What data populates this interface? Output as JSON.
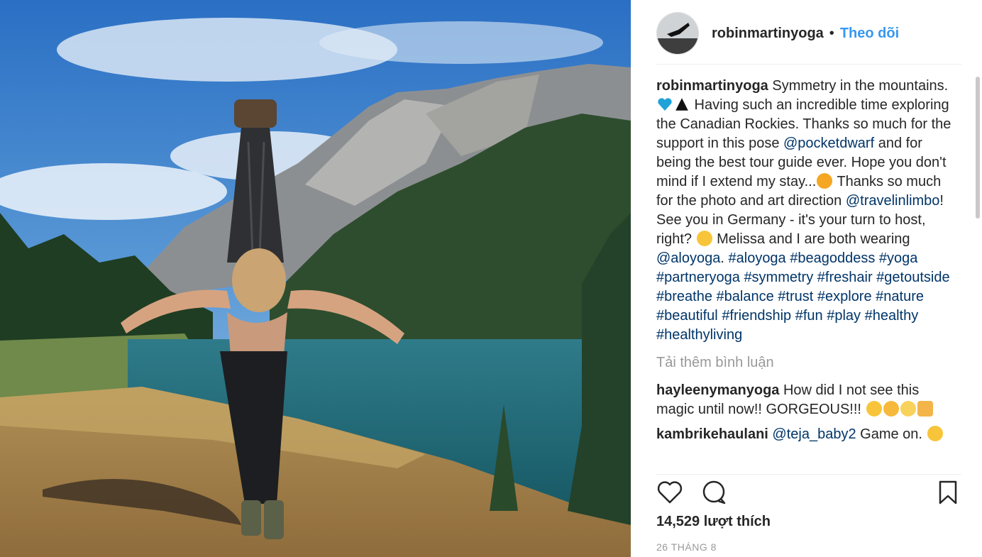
{
  "post": {
    "username": "robinmartinyoga",
    "separator": "•",
    "follow_label": "Theo dõi",
    "photo_icon": "yoga-photo"
  },
  "caption": {
    "username": "robinmartinyoga",
    "part1": " Symmetry in the mountains. ",
    "part2": " Having such an incredible time exploring the Canadian Rockies. Thanks so much for the support in this pose ",
    "mention1": "@pocketdwarf",
    "part3": " and for being the best tour guide ever. Hope you don't mind if I extend my stay...",
    "part4": " Thanks so much for the photo and art direction ",
    "mention2": "@travelinlimbo",
    "part5": "! See you in Germany - it's your turn to host, right? ",
    "part6": " Melissa and I are both wearing ",
    "mention3": "@aloyoga",
    "part7": ".",
    "hashtags": [
      "#aloyoga",
      "#beagoddess",
      "#yoga",
      "#partneryoga",
      "#symmetry",
      "#freshair",
      "#getoutside",
      "#breathe",
      "#balance",
      "#trust",
      "#explore",
      "#nature",
      "#beautiful",
      "#friendship",
      "#fun",
      "#play",
      "#healthy",
      "#healthyliving"
    ]
  },
  "load_more": "Tải thêm bình luận",
  "comments": [
    {
      "username": "hayleenymanyoga",
      "text": " How did I not see this magic until now!! GORGEOUS!!! "
    },
    {
      "username": "kambrikehaulani",
      "mention": "@teja_baby2",
      "text": " Game on. "
    }
  ],
  "icons": [
    "heart-icon",
    "comment-icon",
    "bookmark-icon",
    "blue-heart-emoji",
    "mountain-emoji",
    "wink-emoji",
    "laughing-emoji",
    "heart-eyes-emoji",
    "hug-emoji",
    "scream-emoji",
    "raised-hands-emoji",
    "sunglasses-emoji"
  ],
  "likes": "14,529 lượt thích",
  "date": "26 THÁNG 8"
}
